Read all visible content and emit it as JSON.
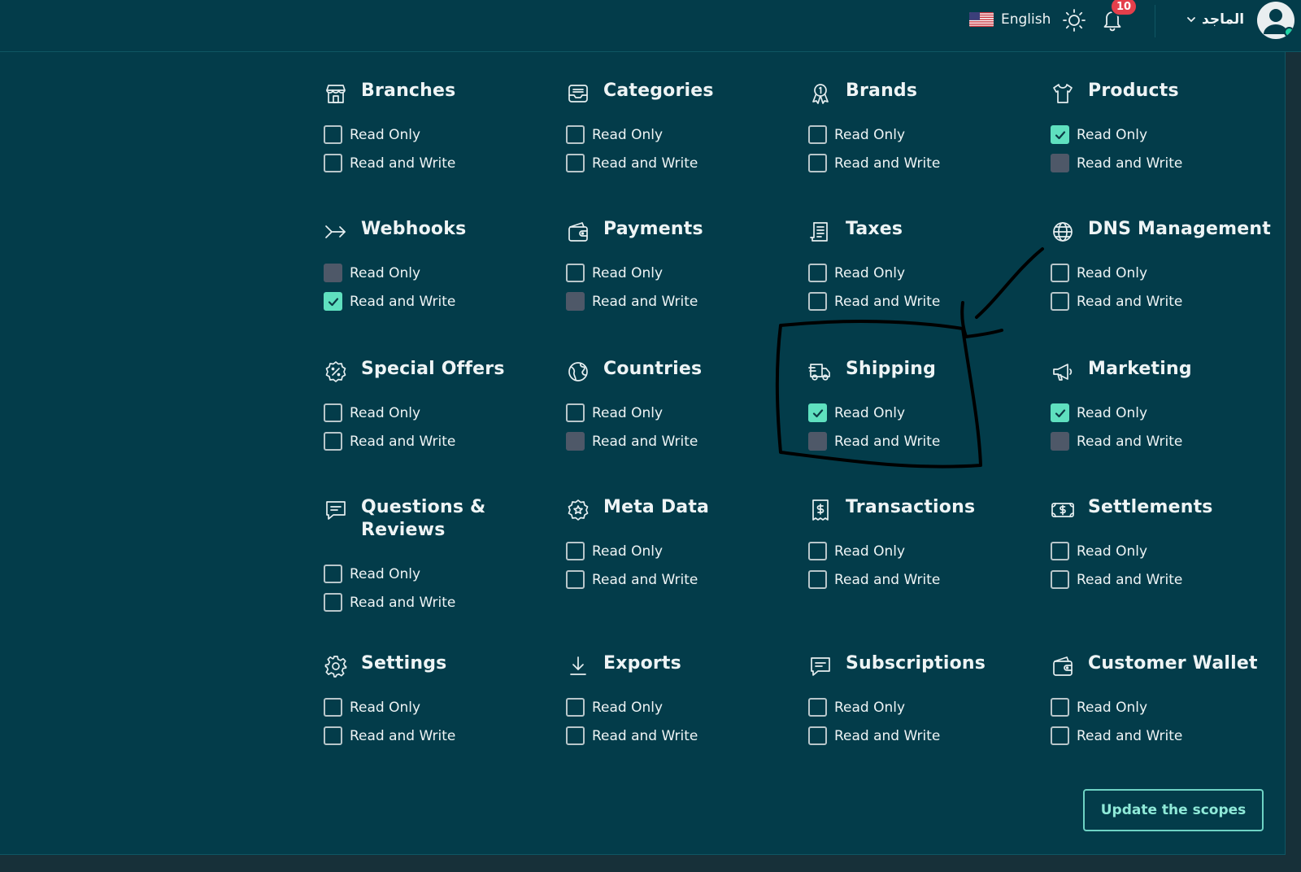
{
  "header": {
    "language_label": "English",
    "notification_count": "10",
    "user_name": "الماجد"
  },
  "options": {
    "read_only": "Read Only",
    "read_write": "Read and Write"
  },
  "scopes": [
    {
      "label": "Branches",
      "icon": "store-icon",
      "read_only": "unchecked",
      "read_write": "unchecked"
    },
    {
      "label": "Categories",
      "icon": "inbox-tray-icon",
      "read_only": "unchecked",
      "read_write": "unchecked"
    },
    {
      "label": "Brands",
      "icon": "award-badge-icon",
      "read_only": "unchecked",
      "read_write": "unchecked"
    },
    {
      "label": "Products",
      "icon": "tshirt-icon",
      "read_only": "checked",
      "read_write": "disabled"
    },
    {
      "label": "Webhooks",
      "icon": "webhook-arrow-icon",
      "read_only": "disabled",
      "read_write": "checked"
    },
    {
      "label": "Payments",
      "icon": "wallet-icon",
      "read_only": "unchecked",
      "read_write": "disabled"
    },
    {
      "label": "Taxes",
      "icon": "document-list-icon",
      "read_only": "unchecked",
      "read_write": "unchecked"
    },
    {
      "label": "DNS Management",
      "icon": "globe-icon",
      "read_only": "unchecked",
      "read_write": "unchecked"
    },
    {
      "label": "Special Offers",
      "icon": "discount-badge-icon",
      "read_only": "unchecked",
      "read_write": "unchecked"
    },
    {
      "label": "Countries",
      "icon": "earth-icon",
      "read_only": "unchecked",
      "read_write": "disabled"
    },
    {
      "label": "Shipping",
      "icon": "delivery-truck-icon",
      "read_only": "checked",
      "read_write": "disabled"
    },
    {
      "label": "Marketing",
      "icon": "megaphone-icon",
      "read_only": "checked",
      "read_write": "disabled"
    },
    {
      "label": "Questions & Reviews",
      "icon": "message-square-icon",
      "read_only": "unchecked",
      "read_write": "unchecked"
    },
    {
      "label": "Meta Data",
      "icon": "star-badge-icon",
      "read_only": "unchecked",
      "read_write": "unchecked"
    },
    {
      "label": "Transactions",
      "icon": "receipt-dollar-icon",
      "read_only": "unchecked",
      "read_write": "unchecked"
    },
    {
      "label": "Settlements",
      "icon": "banknote-icon",
      "read_only": "unchecked",
      "read_write": "unchecked"
    },
    {
      "label": "Settings",
      "icon": "gear-icon",
      "read_only": "unchecked",
      "read_write": "unchecked"
    },
    {
      "label": "Exports",
      "icon": "download-icon",
      "read_only": "unchecked",
      "read_write": "unchecked"
    },
    {
      "label": "Subscriptions",
      "icon": "message-square-icon",
      "read_only": "unchecked",
      "read_write": "unchecked"
    },
    {
      "label": "Customer Wallet",
      "icon": "wallet-icon",
      "read_only": "unchecked",
      "read_write": "unchecked"
    }
  ],
  "footer": {
    "update_label": "Update the scopes"
  },
  "colors": {
    "background": "#033c4a",
    "checked": "#5fe0bf",
    "disabled": "#4e5868",
    "badge": "#e43f4b"
  }
}
